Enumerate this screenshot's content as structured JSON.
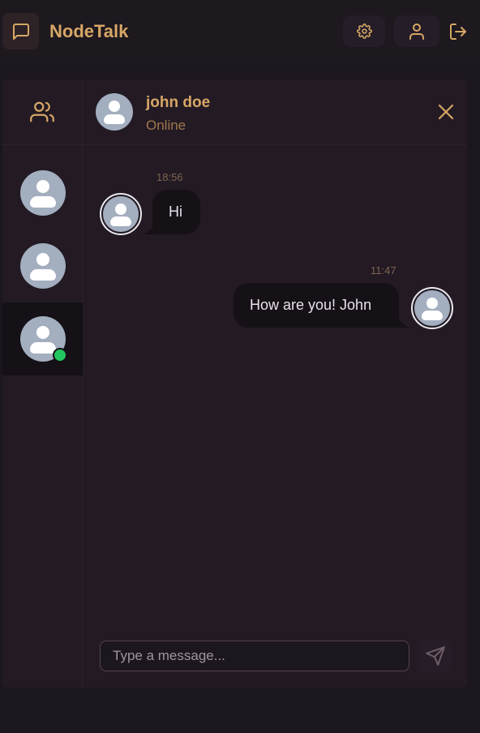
{
  "app": {
    "title": "NodeTalk"
  },
  "chat": {
    "contact_name": "john doe",
    "contact_status": "Online",
    "messages": [
      {
        "direction": "incoming",
        "time": "18:56",
        "text": "Hi"
      },
      {
        "direction": "outgoing",
        "time": "11:47",
        "text": "How are you! John"
      }
    ]
  },
  "composer": {
    "placeholder": "Type a message..."
  },
  "icons": {
    "logo": "message-square-icon",
    "settings": "gear-icon",
    "profile": "user-icon",
    "logout": "logout-icon",
    "contacts": "users-icon",
    "close": "close-icon",
    "send": "send-icon"
  },
  "colors": {
    "accent": "#d7a766",
    "online": "#22c55e",
    "background": "#1c161e",
    "bubble": "#161116"
  }
}
